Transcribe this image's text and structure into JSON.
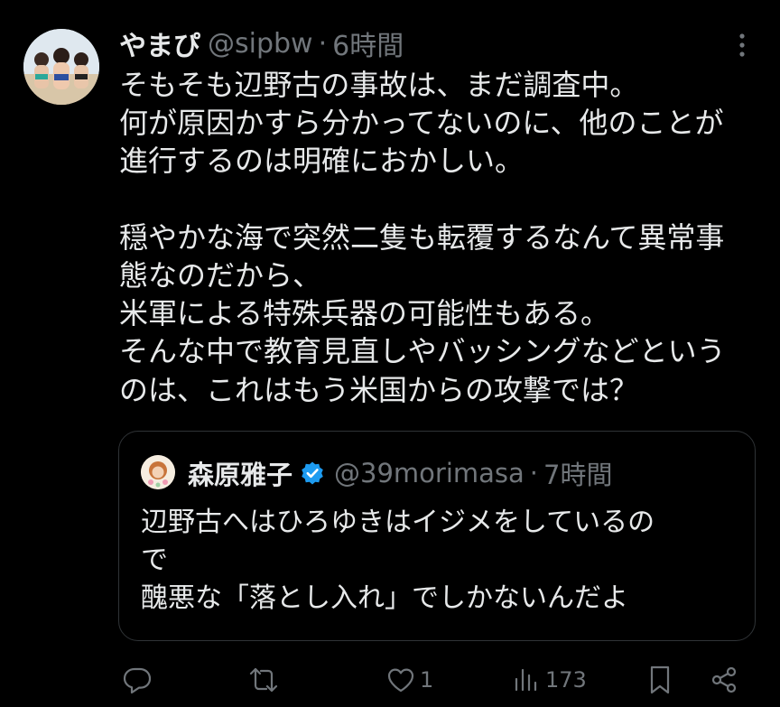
{
  "post": {
    "display_name": "やまぴ",
    "handle": "@sipbw",
    "separator": "·",
    "time": "6時間",
    "text_lines": [
      "そもそも辺野古の事故は、まだ調査中。",
      "何が原因かすら分かってないのに、他のことが",
      "進行するのは明確におかしい。",
      "",
      "穏やかな海で突然二隻も転覆するなんて異常事",
      "態なのだから、",
      "米軍による特殊兵器の可能性もある。",
      "そんな中で教育見直しやバッシングなどという",
      "のは、これはもう米国からの攻撃では？"
    ]
  },
  "quote": {
    "display_name": "森原雅子",
    "handle": "@39morimasa",
    "separator": "·",
    "time": "7時間",
    "text_lines": [
      "辺野古へはひろゆきはイジメをしているの",
      "で",
      "醜悪な「落とし入れ」でしかないんだよ"
    ]
  },
  "actions": {
    "like_count": "1",
    "views_count": "173"
  },
  "colors": {
    "background": "#000000",
    "text": "#e7e9ea",
    "secondary": "#71767b",
    "border": "#2f3336",
    "verified": "#1d9bf0"
  },
  "icons": [
    "more-icon",
    "verified-icon",
    "reply-icon",
    "retweet-icon",
    "like-icon",
    "views-icon",
    "bookmark-icon",
    "share-icon"
  ]
}
